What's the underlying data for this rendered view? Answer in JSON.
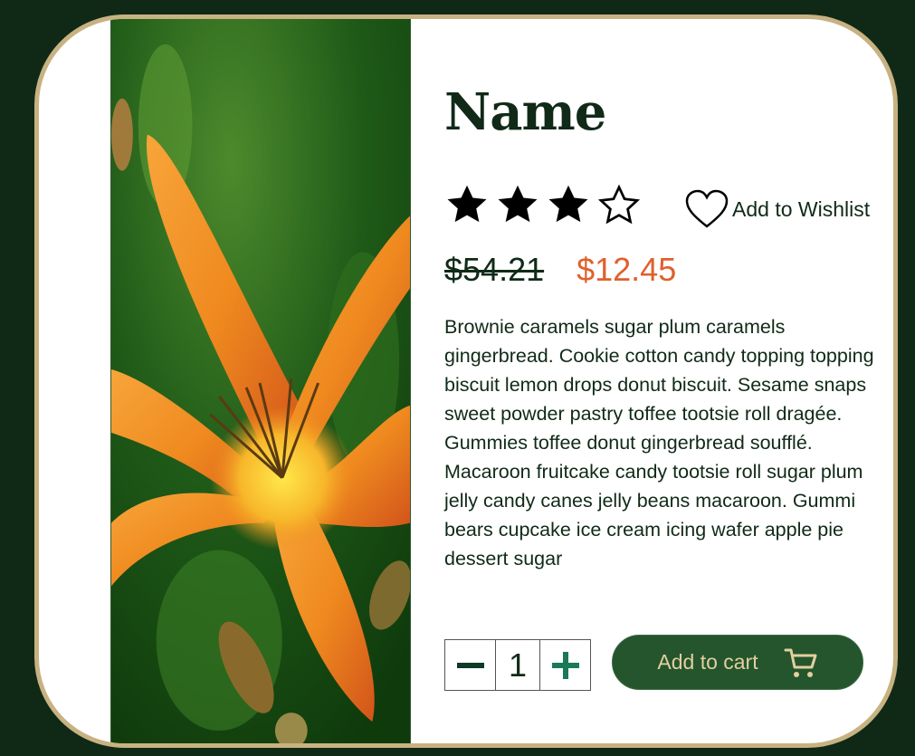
{
  "product": {
    "name": "Name",
    "rating": 3,
    "rating_max": 5,
    "wishlist_label": "Add to Wishlist",
    "old_price": "$54.21",
    "new_price": "$12.45",
    "description": "Brownie caramels sugar plum caramels gingerbread. Cookie cotton candy topping topping biscuit lemon drops donut biscuit. Sesame snaps sweet powder pastry toffee tootsie roll dragée. Gummies toffee donut gingerbread soufflé. Macaroon fruitcake candy tootsie roll sugar plum jelly candy canes jelly beans macaroon. Gummi bears cupcake ice cream icing wafer apple pie dessert sugar"
  },
  "quantity": {
    "value": "1"
  },
  "cart": {
    "label": "Add to cart"
  },
  "icons": {
    "star_filled": "star-filled-icon",
    "star_empty": "star-outline-icon",
    "wishlist": "heart-outline-icon",
    "minus": "minus-icon",
    "plus": "plus-icon",
    "cart": "shopping-cart-icon"
  },
  "colors": {
    "page_background": "#0f2916",
    "card_border": "#c8b282",
    "sale_price": "#e0602c",
    "text": "#102a17",
    "cart_button": "#24552d",
    "cart_label": "#e2cf9f",
    "plus_icon": "#1b7a55"
  }
}
